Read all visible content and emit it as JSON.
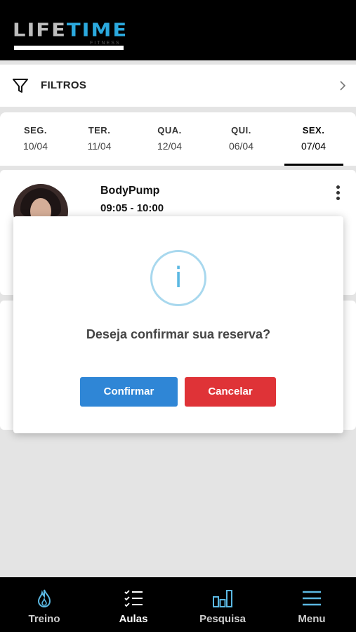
{
  "header": {
    "logo_text_main": "LIFE",
    "logo_text_accent": "TIME",
    "logo_subtext": "FITNESS"
  },
  "filters": {
    "label": "FILTROS"
  },
  "days": [
    {
      "name": "SEG.",
      "date": "10/04"
    },
    {
      "name": "TER.",
      "date": "11/04"
    },
    {
      "name": "QUA.",
      "date": "12/04"
    },
    {
      "name": "QUI.",
      "date": "06/04"
    },
    {
      "name": "SEX.",
      "date": "07/04"
    }
  ],
  "active_day_index": 4,
  "class_card": {
    "title": "BodyPump",
    "time": "09:05 - 10:00"
  },
  "modal": {
    "icon": "info-icon",
    "question": "Deseja confirmar sua reserva?",
    "confirm_label": "Confirmar",
    "cancel_label": "Cancelar"
  },
  "tabs": [
    {
      "label": "Treino",
      "icon": "flame-icon"
    },
    {
      "label": "Aulas",
      "icon": "checklist-icon"
    },
    {
      "label": "Pesquisa",
      "icon": "bar-chart-icon"
    },
    {
      "label": "Menu",
      "icon": "hamburger-icon"
    }
  ],
  "colors": {
    "accent": "#2ba9de",
    "confirm": "#2f86d6",
    "cancel": "#df3337",
    "icon_blue": "#5bb8e2"
  }
}
